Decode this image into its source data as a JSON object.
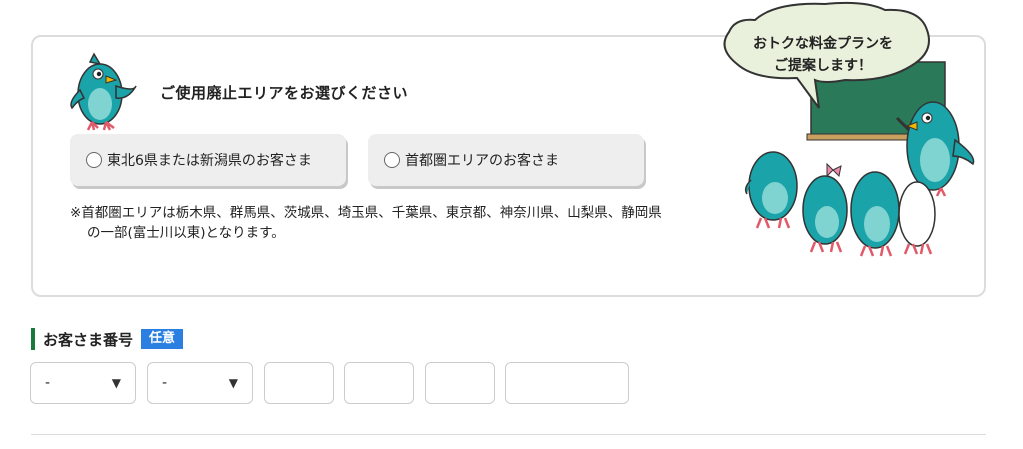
{
  "area_selection": {
    "title": "ご使用廃止エリアをお選びください",
    "options": [
      {
        "label": "東北6県または新潟県のお客さま",
        "selected": false
      },
      {
        "label": "首都圏エリアのお客さま",
        "selected": false
      }
    ],
    "note_line1": "※首都圏エリアは栃木県、群馬県、茨城県、埼玉県、千葉県、東京都、神奈川県、山梨県、静岡県",
    "note_line2": "の一部(富士川以東)となります。",
    "bubble_line1": "おトクな料金プランを",
    "bubble_line2": "ご提案します！"
  },
  "customer_number": {
    "title": "お客さま番号",
    "badge": "任意",
    "selects": [
      {
        "value": "-"
      },
      {
        "value": "-"
      }
    ],
    "fields": [
      {
        "value": ""
      },
      {
        "value": ""
      },
      {
        "value": ""
      },
      {
        "value": ""
      }
    ]
  },
  "colors": {
    "accent_green": "#1a7a3a",
    "badge_blue": "#2a7fe0",
    "bird_teal": "#1aa3a8",
    "board_green": "#2a7a5a"
  },
  "icons": {
    "select_caret": "▼"
  }
}
